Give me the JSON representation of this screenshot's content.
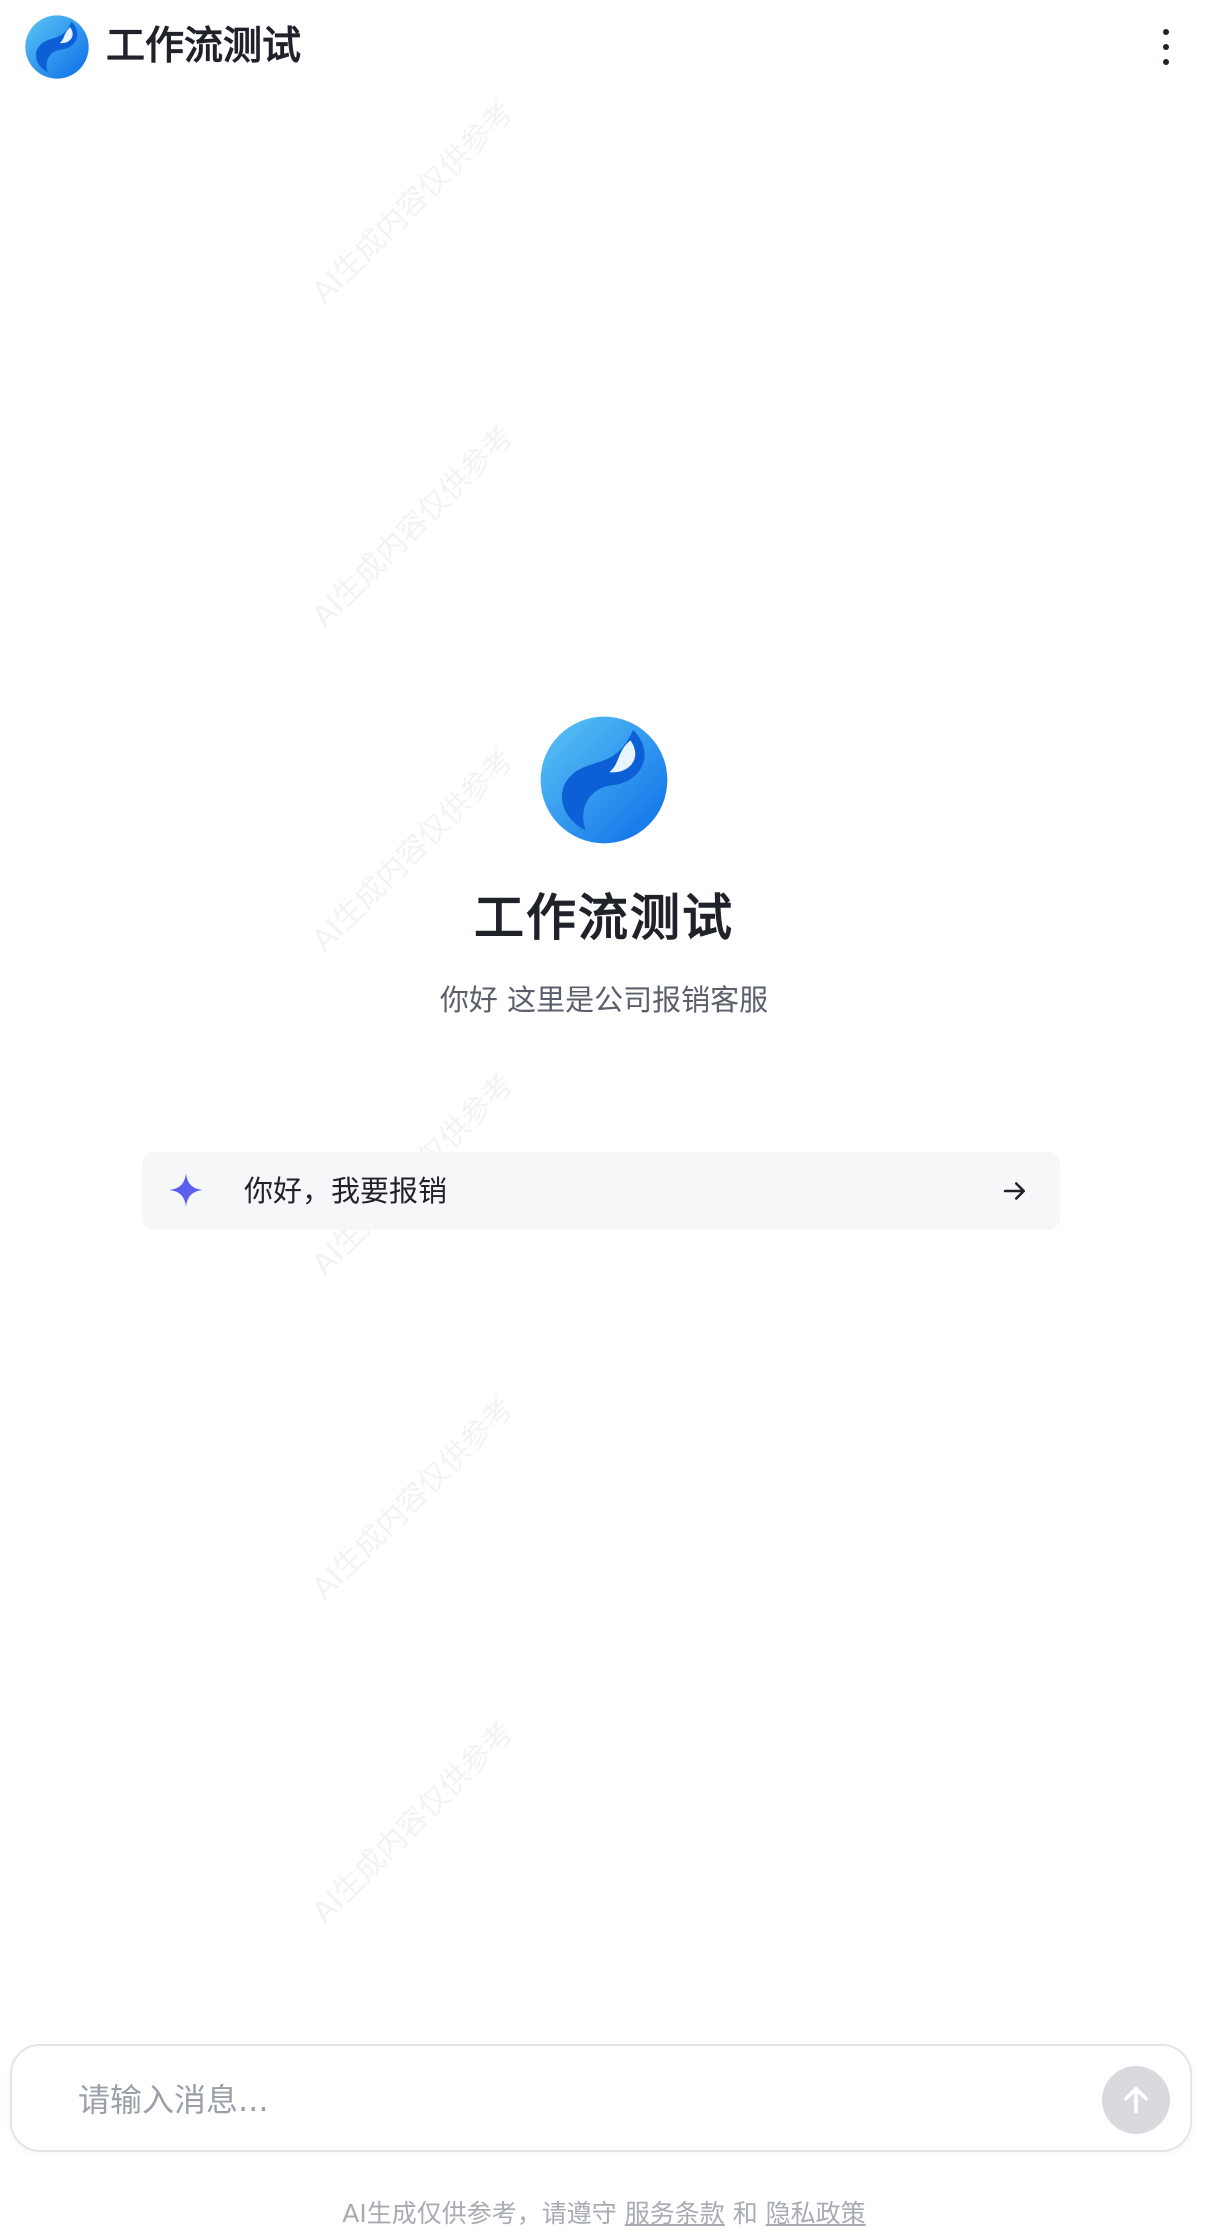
{
  "header": {
    "title": "工作流测试",
    "logo_icon": "bot-logo-icon",
    "menu_icon": "more-vertical-icon"
  },
  "hero": {
    "title": "工作流测试",
    "subtitle": "你好 这里是公司报销客服"
  },
  "suggestion": {
    "text": "你好，我要报销",
    "icon": "sparkle-icon",
    "action_icon": "arrow-right-icon"
  },
  "input": {
    "placeholder": "请输入消息...",
    "value": "",
    "send_icon": "arrow-up-icon"
  },
  "footer": {
    "prefix": "AI生成仅供参考，请遵守",
    "terms_link": "服务条款",
    "conjunction": "和",
    "privacy_link": "隐私政策"
  },
  "watermark": {
    "text": "AI生成内容仅供参考"
  },
  "colors": {
    "accent": "#1a7cf0",
    "sparkle": "#5b5ff0",
    "suggestion_bg": "#f6f7f9",
    "send_bg": "#d8dade"
  }
}
